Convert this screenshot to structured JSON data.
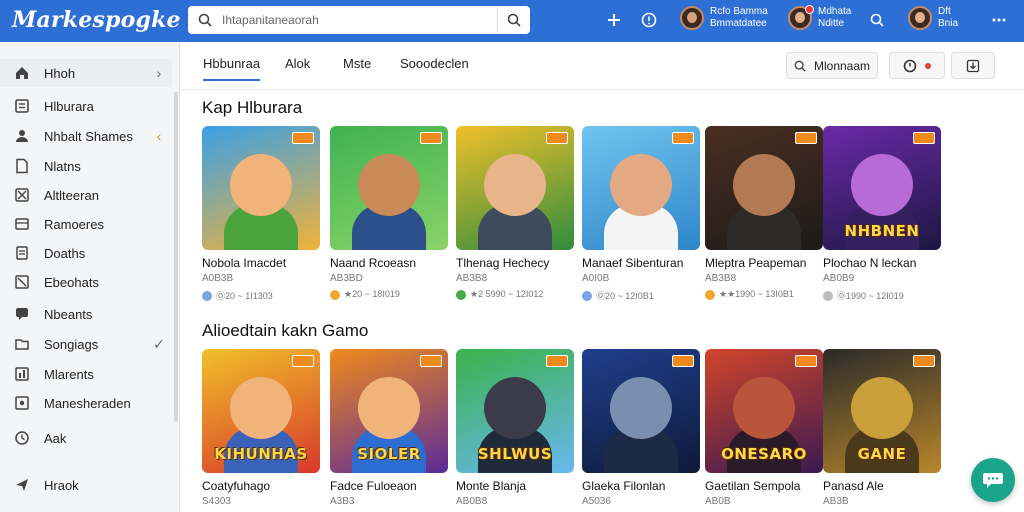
{
  "app": {
    "logo": "Markespogke"
  },
  "search": {
    "placeholder": "Ihtapanitaneaorah"
  },
  "header": {
    "user1": {
      "line1": "Rcfo Bamma",
      "line2": "Bmmatdatee"
    },
    "user2": {
      "line1": "Mdhata",
      "line2": "Nditte"
    },
    "user3": {
      "line1": "Dft",
      "line2": "Bnia"
    }
  },
  "sidebar": {
    "items": [
      {
        "label": "Hhoh",
        "icon": "home-icon",
        "right": "›"
      },
      {
        "label": "Hlburara",
        "icon": "library-icon",
        "right": ""
      },
      {
        "label": "Nhbalt Shames",
        "icon": "person-icon",
        "right": "‹"
      },
      {
        "label": "Nlatns",
        "icon": "document-icon",
        "right": ""
      },
      {
        "label": "Altlteeran",
        "icon": "image-icon",
        "right": ""
      },
      {
        "label": "Ramoeres",
        "icon": "list-icon",
        "right": ""
      },
      {
        "label": "Doaths",
        "icon": "file-icon",
        "right": ""
      },
      {
        "label": "Ebeohats",
        "icon": "grid-icon",
        "right": ""
      },
      {
        "label": "Nbeants",
        "icon": "chat-icon",
        "right": ""
      },
      {
        "label": "Songiags",
        "icon": "folder-icon",
        "right": "✓"
      },
      {
        "label": "Mlarents",
        "icon": "bar-icon",
        "right": ""
      },
      {
        "label": "Manesheraden",
        "icon": "picture-icon",
        "right": ""
      },
      {
        "label": "Aak",
        "icon": "clock-icon",
        "right": ""
      },
      {
        "label": "Hraok",
        "icon": "send-icon",
        "right": ""
      }
    ]
  },
  "tabs": [
    {
      "label": "Hbbunraa",
      "active": true
    },
    {
      "label": "Alok",
      "active": false
    },
    {
      "label": "Mste",
      "active": false
    },
    {
      "label": "Sooodeclen",
      "active": false
    }
  ],
  "toolbar": {
    "filter_label": "Mlonnaam"
  },
  "sections": [
    {
      "title": "Kap Hlburara",
      "cards": [
        {
          "title": "Nobola Imacdet",
          "meta": "A0B3B",
          "rating": "Ⓞ20 ~ 1I1303",
          "dot": "#7aa6e0",
          "c1": "#3aa0e6",
          "c2": "#f2b23a",
          "skin": "#f0b37a",
          "cloth": "#4aa33b",
          "banner": ""
        },
        {
          "title": "Naand Rcoeasn",
          "meta": "AB3BD",
          "rating": "★20 ~ 18I019",
          "dot": "#f0a830",
          "c1": "#3fb24f",
          "c2": "#8bd36a",
          "skin": "#c78a58",
          "cloth": "#2c4f8a",
          "banner": ""
        },
        {
          "title": "Tlhenag Hechecy",
          "meta": "AB3B8",
          "rating": "★2 5990 ~ 12I012",
          "dot": "#49a84a",
          "c1": "#f0c02a",
          "c2": "#2f8c3e",
          "skin": "#e8b48a",
          "cloth": "#3d4b5c",
          "banner": ""
        },
        {
          "title": "Manaef Sibenturan",
          "meta": "A0I0B",
          "rating": "Ⓞ20 ~ 12I0B1",
          "dot": "#7aa6e0",
          "c1": "#6fc5ef",
          "c2": "#2f86c8",
          "skin": "#e2a982",
          "cloth": "#f4f4f4",
          "banner": ""
        },
        {
          "title": "Mleptra Peapeman",
          "meta": "AB3B8",
          "rating": "★★1990 ~ 13I0B1",
          "dot": "#f0a830",
          "c1": "#4a2f22",
          "c2": "#1d1a18",
          "skin": "#b17a55",
          "cloth": "#2d2a28",
          "banner": ""
        },
        {
          "title": "Plochao N leckan",
          "meta": "AB0B9",
          "rating": "Ⓞ1990 ~ 12I019",
          "dot": "#bbbbbb",
          "c1": "#6b2aa8",
          "c2": "#1c1742",
          "skin": "#b86bd6",
          "cloth": "#35205e",
          "banner": "NHBNEN"
        }
      ]
    },
    {
      "title": "Alioedtain kakn Gamo",
      "cards": [
        {
          "title": "Coatyfuhago",
          "meta": "S4303",
          "rating": "",
          "dot": "#f0a830",
          "c1": "#f0c02a",
          "c2": "#d8382c",
          "skin": "#f0b37a",
          "cloth": "#3a62b8",
          "banner": "KIHUNHAS"
        },
        {
          "title": "Fadce Fuloeaon",
          "meta": "A3B3",
          "rating": "",
          "dot": "#f0a830",
          "c1": "#f08a1c",
          "c2": "#5b2b99",
          "skin": "#f0b37a",
          "cloth": "#2d6cd1",
          "banner": "SIOLER"
        },
        {
          "title": "Monte Blanja",
          "meta": "AB0B8",
          "rating": "",
          "dot": "#f0a830",
          "c1": "#3bb14a",
          "c2": "#69b8f0",
          "skin": "#3b3b4a",
          "cloth": "#1f2a3a",
          "banner": "SHLWUS"
        },
        {
          "title": "Glaeka Filonlan",
          "meta": "A5036",
          "rating": "",
          "dot": "#f0a830",
          "c1": "#1f3f8c",
          "c2": "#0f1a3a",
          "skin": "#7a8fb0",
          "cloth": "#1c2a48",
          "banner": ""
        },
        {
          "title": "Gaetilan Sempola",
          "meta": "AB0B",
          "rating": "",
          "dot": "#f0a830",
          "c1": "#d2452a",
          "c2": "#3a1a52",
          "skin": "#b8553a",
          "cloth": "#2a1a2a",
          "banner": "ONESARO"
        },
        {
          "title": "Panasd Ale",
          "meta": "AB3B",
          "rating": "",
          "dot": "#f0a830",
          "c1": "#2a2a2a",
          "c2": "#b8862a",
          "skin": "#c9a03a",
          "cloth": "#4a3a1a",
          "banner": "GANE"
        }
      ]
    }
  ],
  "colors": {
    "brand": "#2e6fd6",
    "accent": "#f08a1c",
    "fab": "#1aa48a"
  }
}
